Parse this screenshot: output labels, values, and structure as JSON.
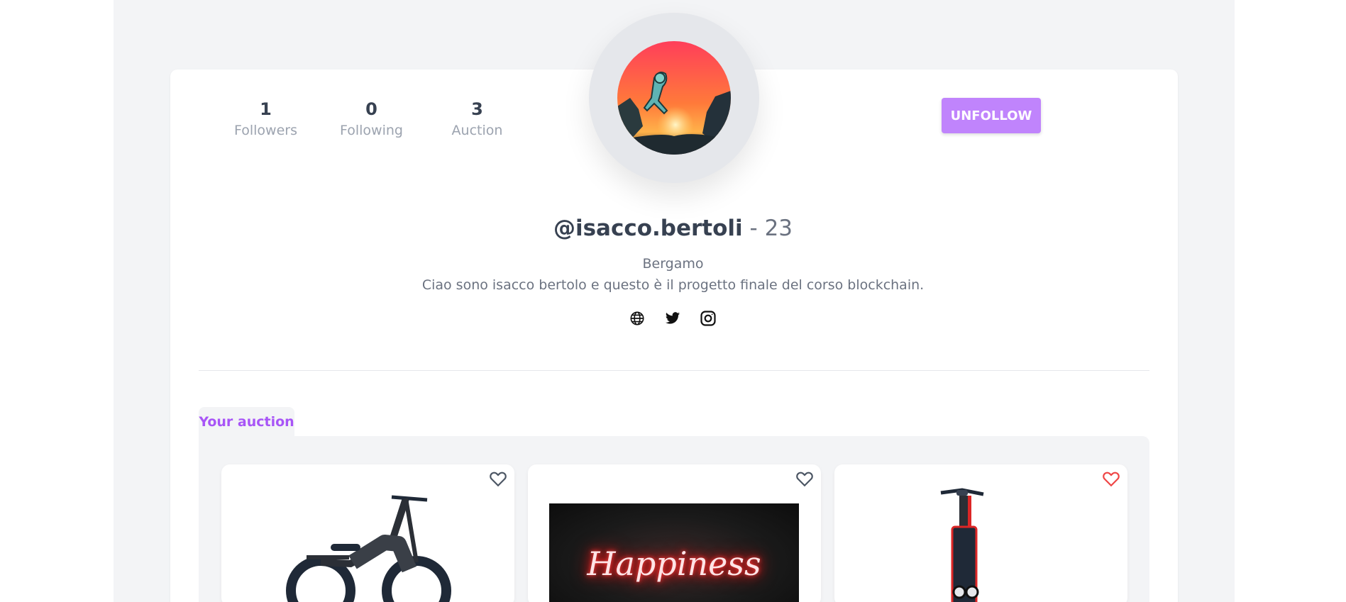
{
  "profile": {
    "stats": [
      {
        "value": "1",
        "label": "Followers"
      },
      {
        "value": "0",
        "label": "Following"
      },
      {
        "value": "3",
        "label": "Auction"
      }
    ],
    "unfollow_label": "UNFOLLOW",
    "username": "@isacco.bertoli",
    "age_text": "- 23",
    "location": "Bergamo",
    "bio": "Ciao sono isacco bertolo e questo è il progetto finale del corso blockchain.",
    "socials": [
      "globe-icon",
      "twitter-icon",
      "instagram-icon"
    ]
  },
  "auction": {
    "tab_label": "Your auction",
    "items": [
      {
        "image": "folding-ebike",
        "liked": false
      },
      {
        "image": "neon-sign",
        "neon_text": "Happiness",
        "liked": false
      },
      {
        "image": "electric-scooter",
        "liked": true
      }
    ]
  },
  "colors": {
    "accent": "#c084fc",
    "tab_text": "#a855f7",
    "liked_heart": "#ef4444",
    "page_bg": "#f3f4f6"
  }
}
